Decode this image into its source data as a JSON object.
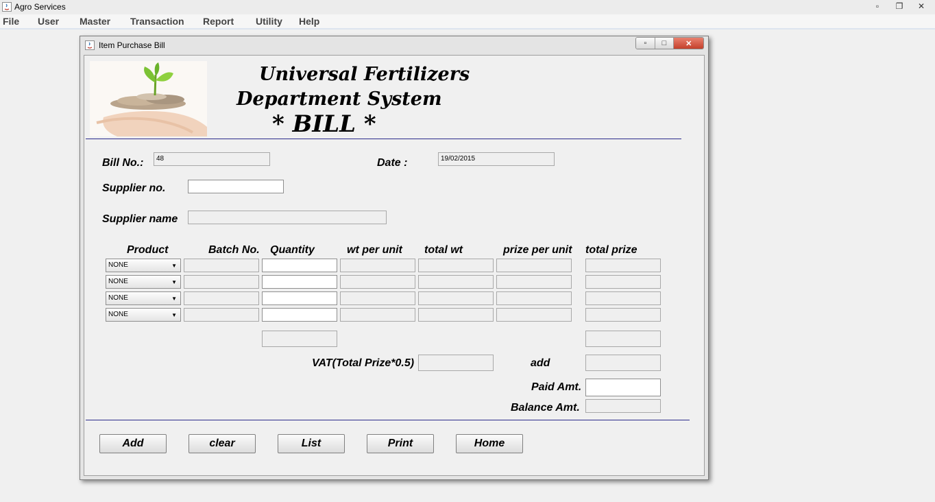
{
  "app": {
    "title": "Agro Services"
  },
  "menu": [
    "File",
    "User",
    "Master",
    "Transaction",
    "Report",
    "Utility",
    "Help"
  ],
  "frame": {
    "title": "Item Purchase Bill"
  },
  "header": {
    "line1": "Universal Fertilizers",
    "line2": "Department System",
    "line3": "* BILL *"
  },
  "bill": {
    "bill_no_label": "Bill No.:",
    "bill_no_value": "48",
    "date_label": "Date :",
    "date_value": "19/02/2015",
    "supplier_no_label": "Supplier no.",
    "supplier_no_value": "",
    "supplier_name_label": "Supplier name",
    "supplier_name_value": ""
  },
  "table": {
    "columns": [
      "Product",
      "Batch No.",
      "Quantity",
      "wt per unit",
      "total wt",
      "prize per unit",
      "total prize"
    ],
    "rows": [
      {
        "product": "NONE"
      },
      {
        "product": "NONE"
      },
      {
        "product": "NONE"
      },
      {
        "product": "NONE"
      }
    ]
  },
  "totals": {
    "vat_label": "VAT(Total Prize*0.5)",
    "add_label": "add",
    "paid_label": "Paid Amt.",
    "balance_label": "Balance Amt."
  },
  "buttons": {
    "add": "Add",
    "clear": "clear",
    "list": "List",
    "print": "Print",
    "home": "Home"
  }
}
